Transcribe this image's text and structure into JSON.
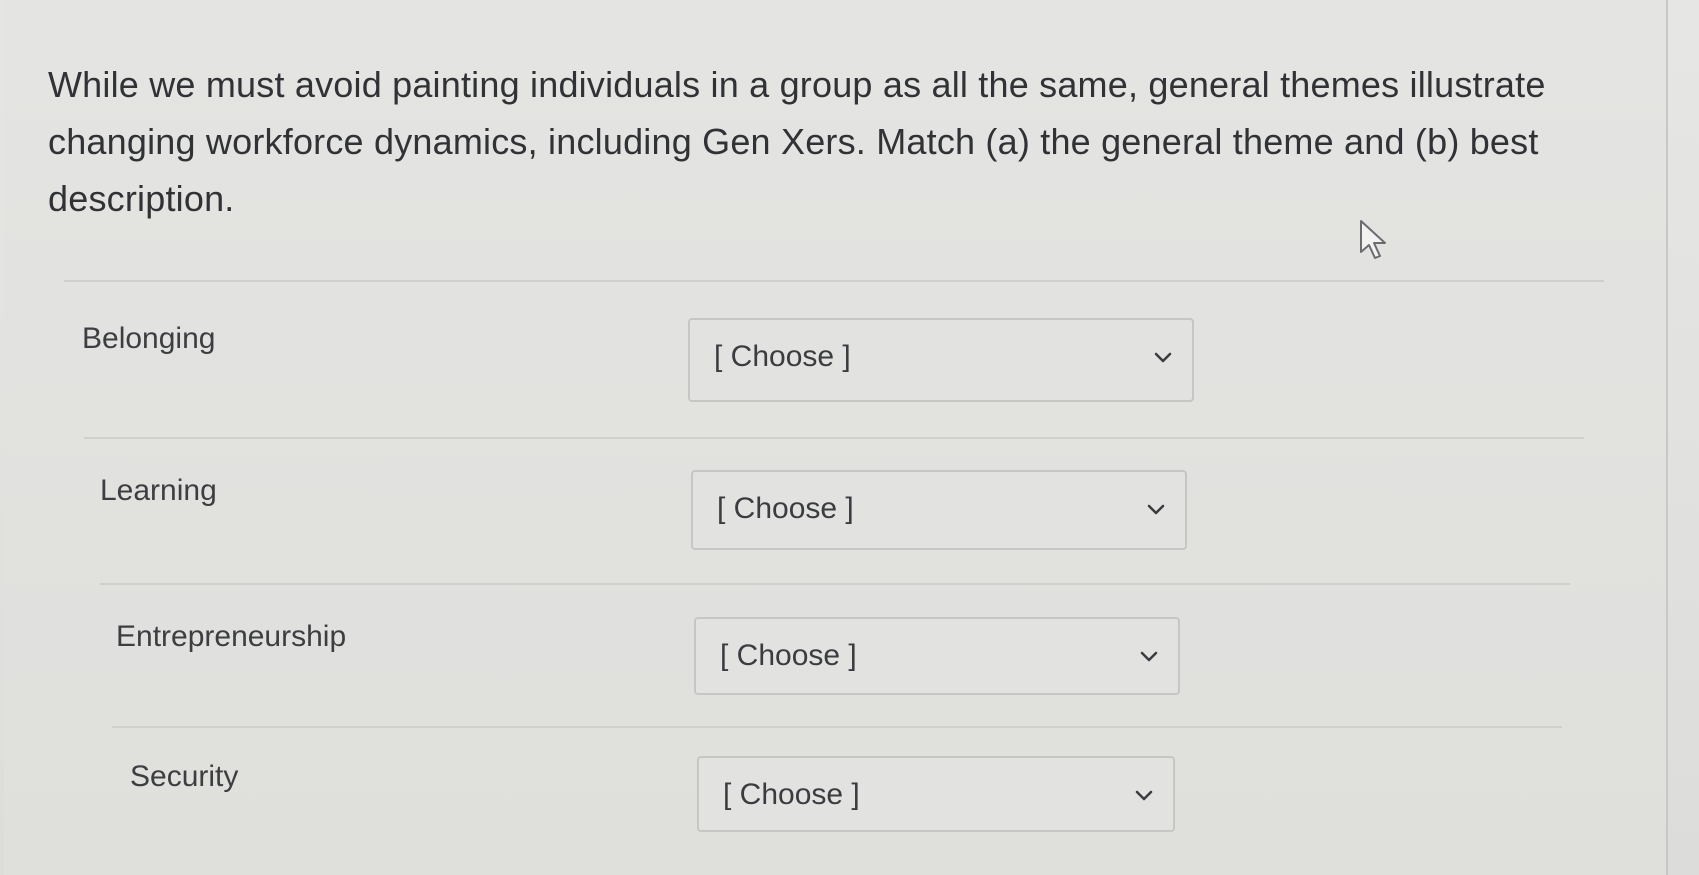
{
  "question": {
    "text": "While we must avoid painting individuals in a group as all the same, general themes illustrate changing workforce dynamics, including Gen Xers. Match (a) the general theme and (b) best description."
  },
  "rows": [
    {
      "label": "Belonging",
      "selected": "[ Choose ]"
    },
    {
      "label": "Learning",
      "selected": "[ Choose ]"
    },
    {
      "label": "Entrepreneurship",
      "selected": "[ Choose ]"
    },
    {
      "label": "Security",
      "selected": "[ Choose ]"
    }
  ],
  "icons": {
    "dropdown": "chevron-down-icon",
    "cursor": "mouse-pointer-icon"
  }
}
